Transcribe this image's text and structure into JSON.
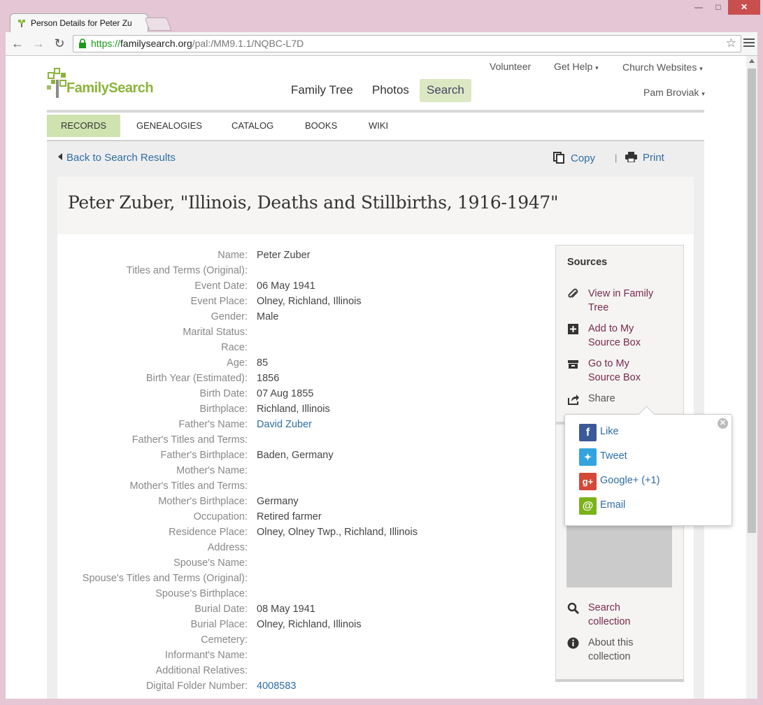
{
  "browser": {
    "tab_title": "Person Details for Peter Zu",
    "url_scheme": "https://",
    "url_host": "familysearch.org",
    "url_path": "/pal:/MM9.1.1/NQBC-L7D"
  },
  "header": {
    "logo_text": "FamilySearch",
    "top_links": [
      "Volunteer",
      "Get Help",
      "Church Websites"
    ],
    "user": "Pam Broviak",
    "main_nav": [
      "Family Tree",
      "Photos",
      "Search"
    ],
    "sub_nav": [
      "RECORDS",
      "GENEALOGIES",
      "CATALOG",
      "BOOKS",
      "WIKI"
    ]
  },
  "actions": {
    "back": "Back to Search Results",
    "copy": "Copy",
    "separator": "|",
    "print": "Print"
  },
  "record": {
    "title": "Peter Zuber, \"Illinois, Deaths and Stillbirths, 1916-1947\"",
    "fields": [
      {
        "label": "Name:",
        "value": "Peter Zuber"
      },
      {
        "label": "Titles and Terms (Original):",
        "value": ""
      },
      {
        "label": "Event Date:",
        "value": "06 May 1941"
      },
      {
        "label": "Event Place:",
        "value": "Olney, Richland, Illinois"
      },
      {
        "label": "Gender:",
        "value": "Male"
      },
      {
        "label": "Marital Status:",
        "value": ""
      },
      {
        "label": "Race:",
        "value": ""
      },
      {
        "label": "Age:",
        "value": "85"
      },
      {
        "label": "Birth Year (Estimated):",
        "value": "1856"
      },
      {
        "label": "Birth Date:",
        "value": "07 Aug 1855"
      },
      {
        "label": "Birthplace:",
        "value": "Richland, Illinois"
      },
      {
        "label": "Father's Name:",
        "value": "David Zuber",
        "link": true
      },
      {
        "label": "Father's Titles and Terms:",
        "value": ""
      },
      {
        "label": "Father's Birthplace:",
        "value": "Baden, Germany"
      },
      {
        "label": "Mother's Name:",
        "value": ""
      },
      {
        "label": "Mother's Titles and Terms:",
        "value": ""
      },
      {
        "label": "Mother's Birthplace:",
        "value": "Germany"
      },
      {
        "label": "Occupation:",
        "value": "Retired farmer"
      },
      {
        "label": "Residence Place:",
        "value": "Olney, Olney Twp., Richland, Illinois"
      },
      {
        "label": "Address:",
        "value": ""
      },
      {
        "label": "Spouse's Name:",
        "value": ""
      },
      {
        "label": "Spouse's Titles and Terms (Original):",
        "value": ""
      },
      {
        "label": "Spouse's Birthplace:",
        "value": ""
      },
      {
        "label": "Burial Date:",
        "value": "08 May 1941"
      },
      {
        "label": "Burial Place:",
        "value": "Olney, Richland, Illinois"
      },
      {
        "label": "Cemetery:",
        "value": ""
      },
      {
        "label": "Informant's Name:",
        "value": ""
      },
      {
        "label": "Additional Relatives:",
        "value": ""
      },
      {
        "label": "Digital Folder Number:",
        "value": "4008583",
        "link": true
      }
    ]
  },
  "sources": {
    "heading": "Sources",
    "view_in_tree": [
      "View in Family",
      "Tree"
    ],
    "add_to_box": [
      "Add to My",
      "Source Box"
    ],
    "go_to_box": [
      "Go to My",
      "Source Box"
    ],
    "share": "Share",
    "search_collection": [
      "Search",
      "collection"
    ],
    "about_collection": [
      "About this",
      "collection"
    ]
  },
  "share_popup": {
    "items": [
      "Like",
      "Tweet",
      "Google+ (+1)",
      "Email"
    ],
    "colors": {
      "facebook": "#3b5998",
      "twitter": "#33a4e0",
      "google": "#d34836",
      "email": "#7ab317"
    }
  }
}
